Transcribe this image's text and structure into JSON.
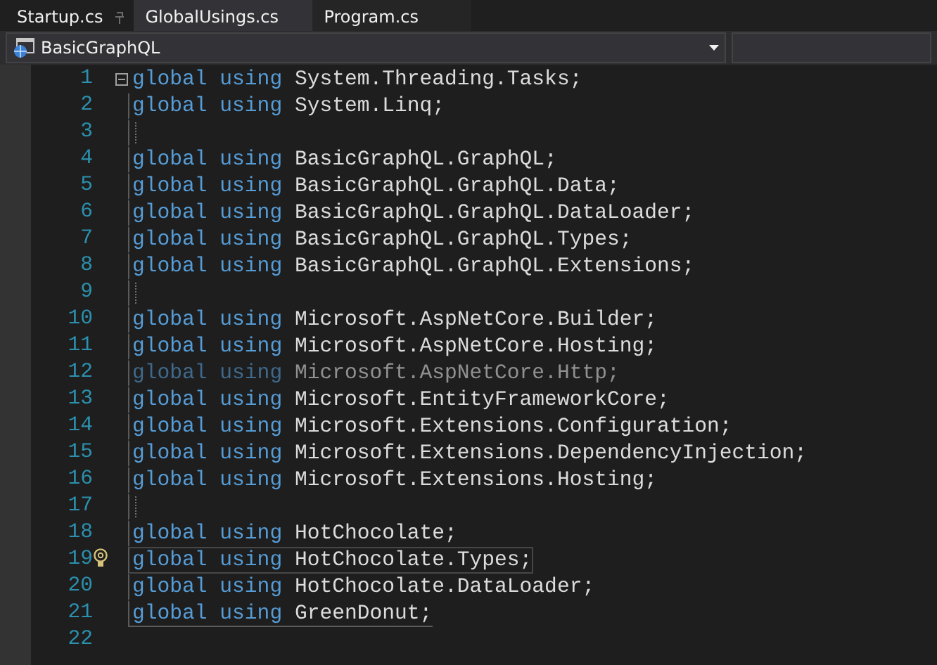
{
  "tabs": [
    {
      "label": "Startup.cs",
      "selected": false,
      "pinned": true
    },
    {
      "label": "GlobalUsings.cs",
      "selected": true,
      "pinned": false
    },
    {
      "label": "Program.cs",
      "selected": false,
      "pinned": false
    }
  ],
  "nav_bar": {
    "project": "BasicGraphQL"
  },
  "editor": {
    "lines": [
      {
        "number": "1",
        "kind": "code",
        "keyword_1": "global",
        "keyword_2": "using",
        "name": "System.Threading.Tasks;",
        "fold": true
      },
      {
        "number": "2",
        "kind": "code",
        "keyword_1": "global",
        "keyword_2": "using",
        "name": "System.Linq;"
      },
      {
        "number": "3",
        "kind": "blank"
      },
      {
        "number": "4",
        "kind": "code",
        "keyword_1": "global",
        "keyword_2": "using",
        "name": "BasicGraphQL.GraphQL;"
      },
      {
        "number": "5",
        "kind": "code",
        "keyword_1": "global",
        "keyword_2": "using",
        "name": "BasicGraphQL.GraphQL.Data;"
      },
      {
        "number": "6",
        "kind": "code",
        "keyword_1": "global",
        "keyword_2": "using",
        "name": "BasicGraphQL.GraphQL.DataLoader;"
      },
      {
        "number": "7",
        "kind": "code",
        "keyword_1": "global",
        "keyword_2": "using",
        "name": "BasicGraphQL.GraphQL.Types;"
      },
      {
        "number": "8",
        "kind": "code",
        "keyword_1": "global",
        "keyword_2": "using",
        "name": "BasicGraphQL.GraphQL.Extensions;"
      },
      {
        "number": "9",
        "kind": "blank"
      },
      {
        "number": "10",
        "kind": "code",
        "keyword_1": "global",
        "keyword_2": "using",
        "name": "Microsoft.AspNetCore.Builder;"
      },
      {
        "number": "11",
        "kind": "code",
        "keyword_1": "global",
        "keyword_2": "using",
        "name": "Microsoft.AspNetCore.Hosting;"
      },
      {
        "number": "12",
        "kind": "code",
        "keyword_1": "global",
        "keyword_2": "using",
        "name": "Microsoft.AspNetCore.Http;",
        "dimmed": true
      },
      {
        "number": "13",
        "kind": "code",
        "keyword_1": "global",
        "keyword_2": "using",
        "name": "Microsoft.EntityFrameworkCore;"
      },
      {
        "number": "14",
        "kind": "code",
        "keyword_1": "global",
        "keyword_2": "using",
        "name": "Microsoft.Extensions.Configuration;"
      },
      {
        "number": "15",
        "kind": "code",
        "keyword_1": "global",
        "keyword_2": "using",
        "name": "Microsoft.Extensions.DependencyInjection;"
      },
      {
        "number": "16",
        "kind": "code",
        "keyword_1": "global",
        "keyword_2": "using",
        "name": "Microsoft.Extensions.Hosting;"
      },
      {
        "number": "17",
        "kind": "blank"
      },
      {
        "number": "18",
        "kind": "code",
        "keyword_1": "global",
        "keyword_2": "using",
        "name": "HotChocolate;"
      },
      {
        "number": "19",
        "kind": "code",
        "keyword_1": "global",
        "keyword_2": "using",
        "name": "HotChocolate.Types;",
        "current": true,
        "lightbulb": true
      },
      {
        "number": "20",
        "kind": "code",
        "keyword_1": "global",
        "keyword_2": "using",
        "name": "HotChocolate.DataLoader;"
      },
      {
        "number": "21",
        "kind": "code",
        "keyword_1": "global",
        "keyword_2": "using",
        "name": "GreenDonut;"
      },
      {
        "number": "22",
        "kind": "empty"
      }
    ]
  }
}
